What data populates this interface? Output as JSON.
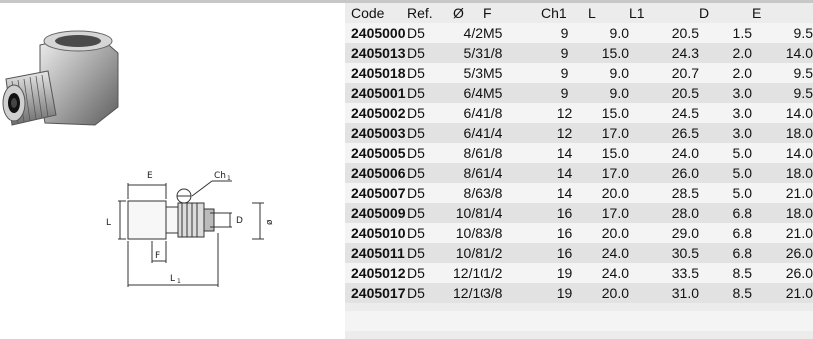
{
  "drawing": {
    "e": "E",
    "ch1": "Ch",
    "ch1_sub": "1",
    "l": "L",
    "d": "D",
    "phi": "ø",
    "f": "F",
    "l1": "L",
    "l1_sub": "1"
  },
  "table": {
    "headers": [
      "Code",
      "Ref.",
      "Ø",
      "F",
      "Ch1",
      "L",
      "L1",
      "D",
      "E"
    ],
    "rows": [
      [
        "2405000",
        "D5",
        "4/2",
        "M5",
        "9",
        "9.0",
        "20.5",
        "1.5",
        "9.5"
      ],
      [
        "2405013",
        "D5",
        "5/3",
        "1/8",
        "9",
        "15.0",
        "24.3",
        "2.0",
        "14.0"
      ],
      [
        "2405018",
        "D5",
        "5/3",
        "M5",
        "9",
        "9.0",
        "20.7",
        "2.0",
        "9.5"
      ],
      [
        "2405001",
        "D5",
        "6/4",
        "M5",
        "9",
        "9.0",
        "20.5",
        "3.0",
        "9.5"
      ],
      [
        "2405002",
        "D5",
        "6/4",
        "1/8",
        "12",
        "15.0",
        "24.5",
        "3.0",
        "14.0"
      ],
      [
        "2405003",
        "D5",
        "6/4",
        "1/4",
        "12",
        "17.0",
        "26.5",
        "3.0",
        "18.0"
      ],
      [
        "2405005",
        "D5",
        "8/6",
        "1/8",
        "14",
        "15.0",
        "24.0",
        "5.0",
        "14.0"
      ],
      [
        "2405006",
        "D5",
        "8/6",
        "1/4",
        "14",
        "17.0",
        "26.0",
        "5.0",
        "18.0"
      ],
      [
        "2405007",
        "D5",
        "8/6",
        "3/8",
        "14",
        "20.0",
        "28.5",
        "5.0",
        "21.0"
      ],
      [
        "2405009",
        "D5",
        "10/8",
        "1/4",
        "16",
        "17.0",
        "28.0",
        "6.8",
        "18.0"
      ],
      [
        "2405010",
        "D5",
        "10/8",
        "3/8",
        "16",
        "20.0",
        "29.0",
        "6.8",
        "21.0"
      ],
      [
        "2405011",
        "D5",
        "10/8",
        "1/2",
        "16",
        "24.0",
        "30.5",
        "6.8",
        "26.0"
      ],
      [
        "2405012",
        "D5",
        "12/10",
        "1/2",
        "19",
        "24.0",
        "33.5",
        "8.5",
        "26.0"
      ],
      [
        "2405017",
        "D5",
        "12/10",
        "3/8",
        "19",
        "20.0",
        "31.0",
        "8.5",
        "21.0"
      ]
    ]
  }
}
